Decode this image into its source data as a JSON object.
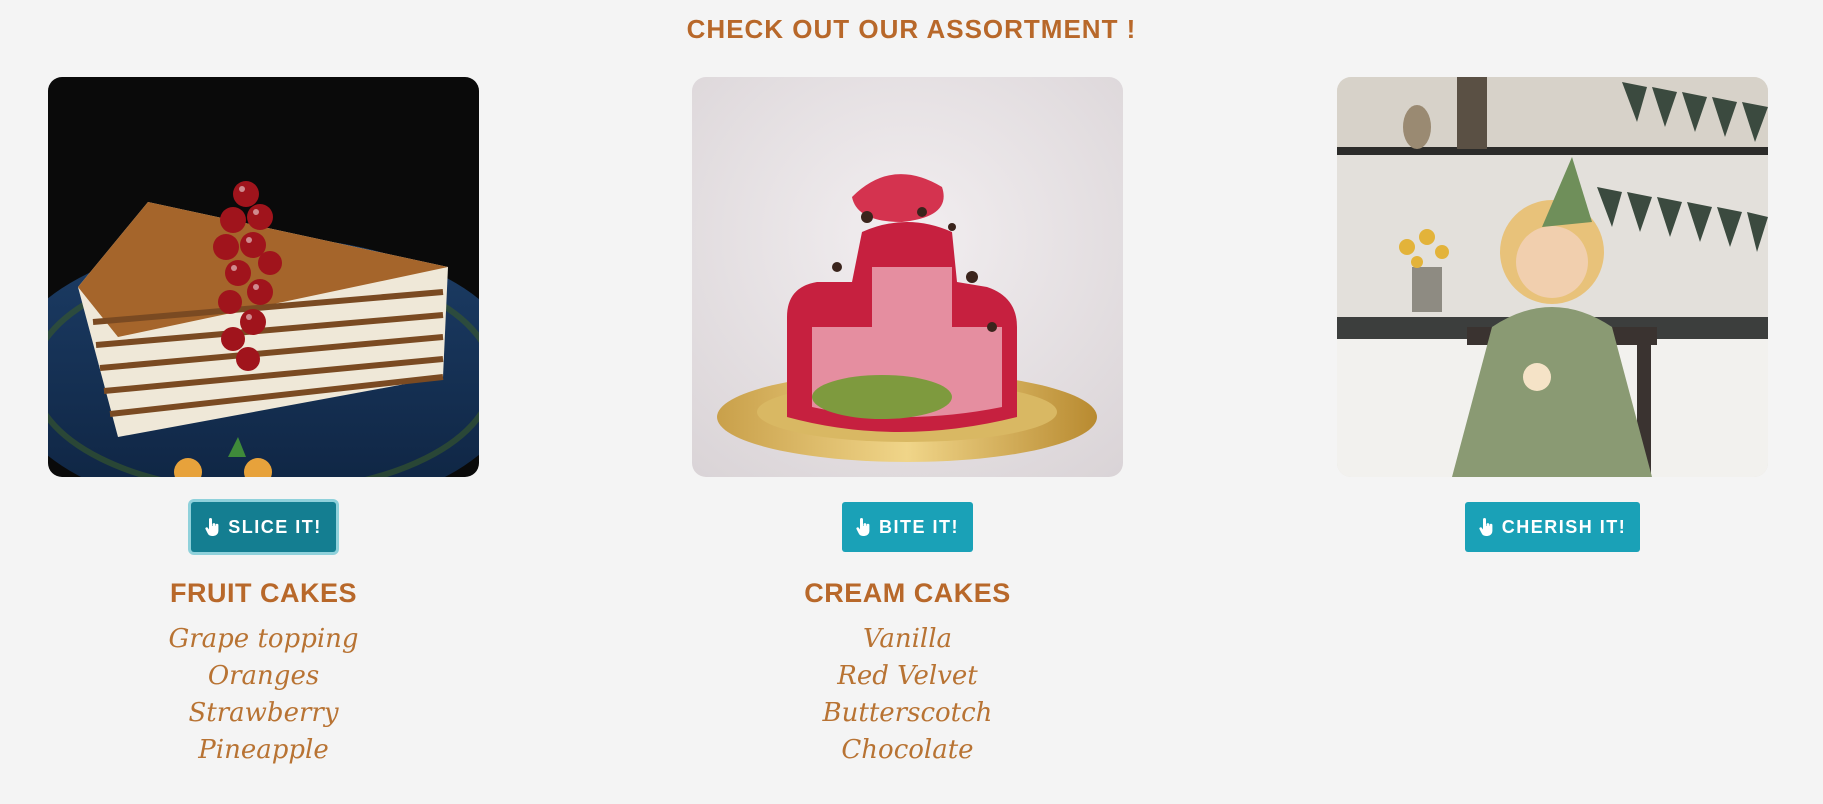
{
  "heading": "CHECK OUT OUR ASSORTMENT !",
  "colors": {
    "background": "#f4f4f4",
    "accent_text": "#b8682a",
    "button": "#1aa1b7",
    "button_active": "#147e91"
  },
  "cards": [
    {
      "image_icon": "layered-honey-cake-photo",
      "button_label": "SLICE IT!",
      "button_icon": "hand-pointer-icon",
      "category": "FRUIT CAKES",
      "flavors": [
        "Grape topping",
        "Oranges",
        "Strawberry",
        "Pineapple"
      ]
    },
    {
      "image_icon": "pink-mousse-cake-photo",
      "button_label": "BITE IT!",
      "button_icon": "hand-pointer-icon",
      "category": "CREAM CAKES",
      "flavors": [
        "Vanilla",
        "Red Velvet",
        "Butterscotch",
        "Chocolate"
      ]
    },
    {
      "image_icon": "birthday-girl-photo",
      "button_label": "CHERISH IT!",
      "button_icon": "hand-pointer-icon",
      "category": "",
      "flavors": []
    }
  ]
}
